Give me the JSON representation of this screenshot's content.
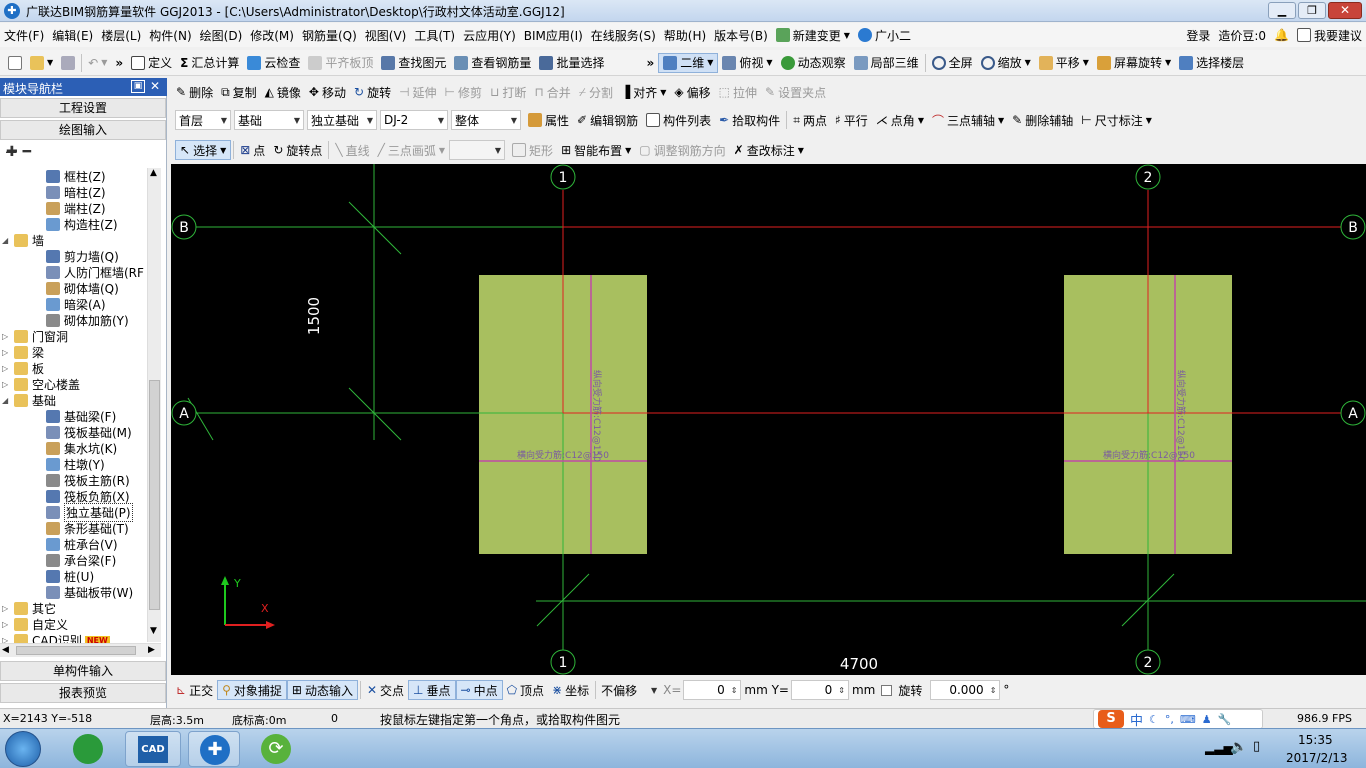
{
  "title_bar": {
    "title": "广联达BIM钢筋算量软件 GGJ2013 - [C:\\Users\\Administrator\\Desktop\\行政村文体活动室.GGJ12]"
  },
  "menu": {
    "items": [
      "文件(F)",
      "编辑(E)",
      "楼层(L)",
      "构件(N)",
      "绘图(D)",
      "修改(M)",
      "钢筋量(Q)",
      "视图(V)",
      "工具(T)",
      "云应用(Y)",
      "BIM应用(I)",
      "在线服务(S)",
      "帮助(H)",
      "版本号(B)",
      "新建变更",
      "广小二"
    ],
    "login": "登录",
    "price_beans": "造价豆:0",
    "suggest": "我要建议"
  },
  "toolbar1": {
    "items": [
      "定义",
      "汇总计算",
      "云检查",
      "平齐板顶",
      "查找图元",
      "查看钢筋量",
      "批量选择"
    ],
    "view_items": [
      "二维",
      "俯视",
      "动态观察",
      "局部三维",
      "全屏",
      "缩放",
      "平移",
      "屏幕旋转",
      "选择楼层"
    ]
  },
  "nav": {
    "title": "模块导航栏",
    "project_settings": "工程设置",
    "drawing_input": "绘图输入",
    "tree": [
      {
        "label": "框柱(Z)",
        "level": 2
      },
      {
        "label": "暗柱(Z)",
        "level": 2
      },
      {
        "label": "端柱(Z)",
        "level": 2
      },
      {
        "label": "构造柱(Z)",
        "level": 2
      },
      {
        "label": "墙",
        "level": 1,
        "open": true
      },
      {
        "label": "剪力墙(Q)",
        "level": 2
      },
      {
        "label": "人防门框墙(RF",
        "level": 2
      },
      {
        "label": "砌体墙(Q)",
        "level": 2
      },
      {
        "label": "暗梁(A)",
        "level": 2
      },
      {
        "label": "砌体加筋(Y)",
        "level": 2
      },
      {
        "label": "门窗洞",
        "level": 1,
        "open": false
      },
      {
        "label": "梁",
        "level": 1,
        "open": false
      },
      {
        "label": "板",
        "level": 1,
        "open": false
      },
      {
        "label": "空心楼盖",
        "level": 1,
        "open": false
      },
      {
        "label": "基础",
        "level": 1,
        "open": true
      },
      {
        "label": "基础梁(F)",
        "level": 2
      },
      {
        "label": "筏板基础(M)",
        "level": 2
      },
      {
        "label": "集水坑(K)",
        "level": 2
      },
      {
        "label": "柱墩(Y)",
        "level": 2
      },
      {
        "label": "筏板主筋(R)",
        "level": 2
      },
      {
        "label": "筏板负筋(X)",
        "level": 2
      },
      {
        "label": "独立基础(P)",
        "level": 2,
        "selected": true
      },
      {
        "label": "条形基础(T)",
        "level": 2
      },
      {
        "label": "桩承台(V)",
        "level": 2
      },
      {
        "label": "承台梁(F)",
        "level": 2
      },
      {
        "label": "桩(U)",
        "level": 2
      },
      {
        "label": "基础板带(W)",
        "level": 2
      },
      {
        "label": "其它",
        "level": 1,
        "open": false
      },
      {
        "label": "自定义",
        "level": 1,
        "open": false
      },
      {
        "label": "CAD识别",
        "level": 1,
        "open": false,
        "badge": "NEW"
      }
    ],
    "single_input": "单构件输入",
    "report_preview": "报表预览"
  },
  "toolbar2": {
    "items": [
      "删除",
      "复制",
      "镜像",
      "移动",
      "旋转",
      "延伸",
      "修剪",
      "打断",
      "合并",
      "分割",
      "对齐",
      "偏移",
      "拉伸",
      "设置夹点"
    ]
  },
  "toolbar3": {
    "floor": "首层",
    "category": "基础",
    "type": "独立基础",
    "component": "DJ-2",
    "whole": "整体",
    "items": [
      "属性",
      "编辑钢筋",
      "构件列表",
      "拾取构件",
      "两点",
      "平行",
      "点角",
      "三点辅轴",
      "删除辅轴",
      "尺寸标注"
    ]
  },
  "toolbar4": {
    "items": [
      "选择",
      "点",
      "旋转点",
      "直线",
      "三点画弧",
      "矩形",
      "智能布置",
      "调整钢筋方向",
      "查改标注"
    ]
  },
  "canvas": {
    "axis_labels": {
      "col1": "1",
      "col2": "2",
      "rowA": "A",
      "rowB": "B"
    },
    "dim_vertical": "1500",
    "dim_horizontal": "4700",
    "rebar_h": "横向受力筋:C12@150",
    "rebar_v": "纵向受力筋:C12@150",
    "ucs_x": "X",
    "ucs_y": "Y"
  },
  "snapbar": {
    "items": [
      "正交",
      "对象捕捉",
      "动态输入",
      "交点",
      "垂点",
      "中点",
      "顶点",
      "坐标"
    ],
    "offset_mode": "不偏移",
    "x_label": "X=",
    "x_value": "0",
    "y_label": "mm Y=",
    "y_value": "0",
    "unit": "mm",
    "rotate_label": "旋转",
    "rotate_value": "0.000",
    "degree": "°"
  },
  "status": {
    "coords": "X=2143 Y=-518",
    "floor_height": "层高:3.5m",
    "bottom_elev": "底标高:0m",
    "zero": "0",
    "hint": "按鼠标左键指定第一个角点，或拾取构件图元",
    "fps": "986.9 FPS"
  },
  "taskbar": {
    "time": "15:35",
    "date": "2017/2/13",
    "ime": "中"
  }
}
